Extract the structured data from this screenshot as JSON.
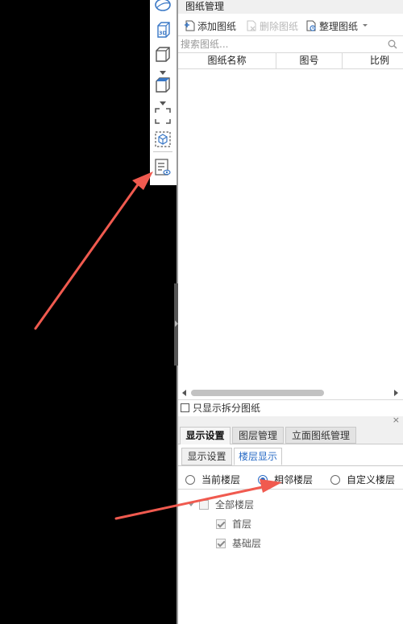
{
  "toolbar": {
    "icons": [
      "ellipse-view-icon",
      "3d-view-icon",
      "cube-view-icon",
      "cube-top-icon",
      "dashed-select-icon",
      "dashed-cube-icon",
      "drawing-list-view-icon"
    ],
    "label_3d": "3D"
  },
  "panel": {
    "title": "图纸管理",
    "actions": {
      "add": "添加图纸",
      "delete": "删除图纸",
      "organize": "整理图纸"
    },
    "search": {
      "placeholder": "搜索图纸..."
    },
    "columns": [
      "图纸名称",
      "图号",
      "比例"
    ],
    "only_split_label": "只显示拆分图纸"
  },
  "bottom_panel": {
    "close": "×",
    "tabs": [
      "显示设置",
      "图层管理",
      "立面图纸管理"
    ],
    "active_tab": "显示设置",
    "subtabs": [
      "显示设置",
      "楼层显示"
    ],
    "active_subtab": "楼层显示",
    "radios": [
      "当前楼层",
      "相邻楼层",
      "自定义楼层"
    ],
    "selected_radio": "相邻楼层",
    "tree": {
      "root": "全部楼层",
      "children": [
        "首层",
        "基础层"
      ]
    }
  },
  "colors": {
    "arrow": "#f05a4f",
    "accent": "#2a6cc6"
  }
}
